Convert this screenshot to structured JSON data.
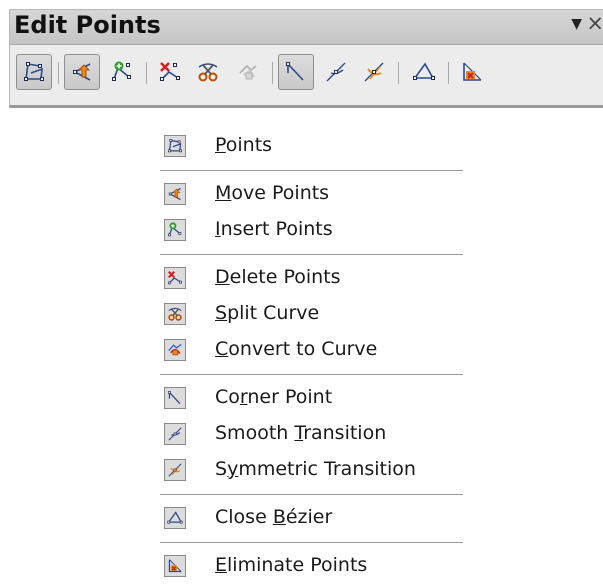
{
  "toolbar": {
    "title": "Edit Points",
    "dropdown_glyph": "▼",
    "close_glyph": "×",
    "buttons": [
      {
        "icon": "points-icon",
        "active": true
      },
      {
        "icon": "move-points-icon",
        "active": true
      },
      {
        "icon": "insert-points-icon",
        "active": false
      },
      {
        "icon": "delete-points-icon",
        "active": false
      },
      {
        "icon": "split-curve-icon",
        "active": false
      },
      {
        "icon": "convert-to-curve-icon",
        "active": false,
        "disabled": true
      },
      {
        "icon": "corner-point-icon",
        "active": true
      },
      {
        "icon": "smooth-transition-icon",
        "active": false
      },
      {
        "icon": "symmetric-transition-icon",
        "active": false
      },
      {
        "icon": "close-bezier-icon",
        "active": false
      },
      {
        "icon": "eliminate-points-icon",
        "active": false
      }
    ]
  },
  "menu": {
    "items": [
      {
        "pre": "",
        "key": "P",
        "post": "oints",
        "icon": "points-icon"
      },
      {
        "pre": "",
        "key": "M",
        "post": "ove Points",
        "icon": "move-points-icon"
      },
      {
        "pre": "",
        "key": "I",
        "post": "nsert Points",
        "icon": "insert-points-icon"
      },
      {
        "pre": "",
        "key": "D",
        "post": "elete Points",
        "icon": "delete-points-icon"
      },
      {
        "pre": "",
        "key": "S",
        "post": "plit Curve",
        "icon": "split-curve-icon"
      },
      {
        "pre": "",
        "key": "C",
        "post": "onvert to Curve",
        "icon": "convert-to-curve-icon"
      },
      {
        "pre": "Co",
        "key": "r",
        "post": "ner Point",
        "icon": "corner-point-icon"
      },
      {
        "pre": "Smooth ",
        "key": "T",
        "post": "ransition",
        "icon": "smooth-transition-icon"
      },
      {
        "pre": "S",
        "key": "y",
        "post": "mmetric Transition",
        "icon": "symmetric-transition-icon"
      },
      {
        "pre": "Close ",
        "key": "B",
        "post": "ézier",
        "icon": "close-bezier-icon"
      },
      {
        "pre": "",
        "key": "E",
        "post": "liminate Points",
        "icon": "eliminate-points-icon"
      }
    ]
  },
  "colors": {
    "accent_red": "#d42020",
    "accent_orange": "#f08a18",
    "accent_green": "#2e9e2e",
    "accent_blue": "#2a60c0"
  }
}
